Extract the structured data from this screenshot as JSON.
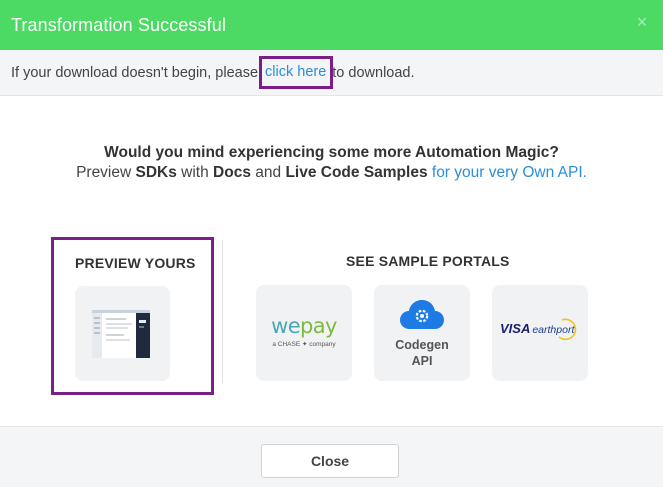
{
  "header": {
    "title": "Transformation Successful",
    "close_glyph": "×",
    "background": "#4cd964"
  },
  "notice": {
    "prefix": "If your download doesn't begin, please ",
    "link_text": "click here",
    "suffix": " to download."
  },
  "question": {
    "line1": "Would you mind experiencing some more Automation Magic?",
    "line2_word1": "Preview ",
    "line2_sdks": "SDKs",
    "line2_word2": " with ",
    "line2_docs": "Docs",
    "line2_word3": " and ",
    "line2_live": "Live Code Samples",
    "line2_link": " for your very Own API."
  },
  "preview": {
    "heading": "PREVIEW YOURS"
  },
  "portals": {
    "heading": "SEE SAMPLE PORTALS",
    "wepay": {
      "we": "we",
      "pay": "pay",
      "sub": "a CHASE ✦ company"
    },
    "codegen": {
      "line1": "Codegen",
      "line2": "API"
    },
    "visa": {
      "visa": "VISA",
      "earthport": "earthport"
    }
  },
  "footer": {
    "close_label": "Close"
  },
  "colors": {
    "accent_link": "#2b8ed6",
    "highlight_border": "#7a1f8a",
    "success": "#4cd964"
  }
}
